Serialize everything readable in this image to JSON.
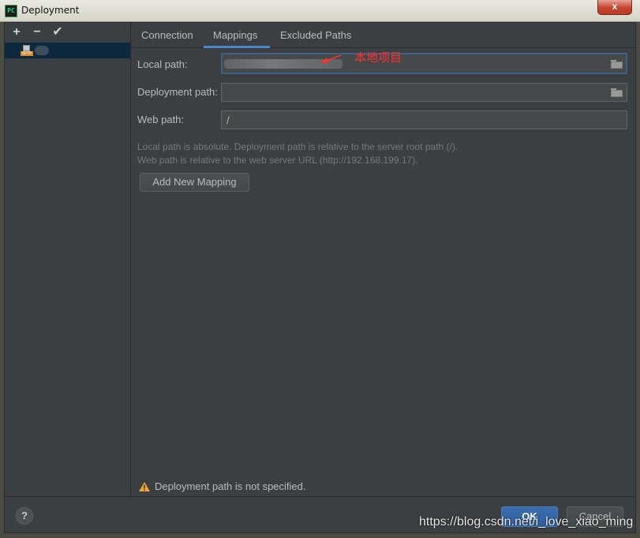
{
  "window": {
    "title": "Deployment",
    "app_icon_text": "PC",
    "close_glyph": "x"
  },
  "toolbar": {
    "add": "+",
    "remove": "−",
    "apply": "✔"
  },
  "server_icon_tag": "SFTP",
  "tabs": [
    "Connection",
    "Mappings",
    "Excluded Paths"
  ],
  "active_tab": "Mappings",
  "form": {
    "local_path_label": "Local path:",
    "local_path_value": "",
    "deployment_path_label": "Deployment path:",
    "deployment_path_value": "",
    "web_path_label": "Web path:",
    "web_path_value": "/"
  },
  "hints": {
    "line1": "Local path is absolute. Deployment path is relative to the server root path (/).",
    "line2": "Web path is relative to the web server URL (http://192.168.199.17)."
  },
  "add_mapping_label": "Add New Mapping",
  "warning_text": "Deployment path is not specified.",
  "buttons": {
    "help": "?",
    "ok": "OK",
    "cancel": "Cancel"
  },
  "annotation_text": "本地项目",
  "watermark": "https://blog.csdn.net/i_love_xiao_ming",
  "colors": {
    "background": "#3c3f41",
    "selection": "#0d293e",
    "accent": "#4a88c7",
    "annotation": "#ff2f2f",
    "warning": "#f0a732"
  }
}
